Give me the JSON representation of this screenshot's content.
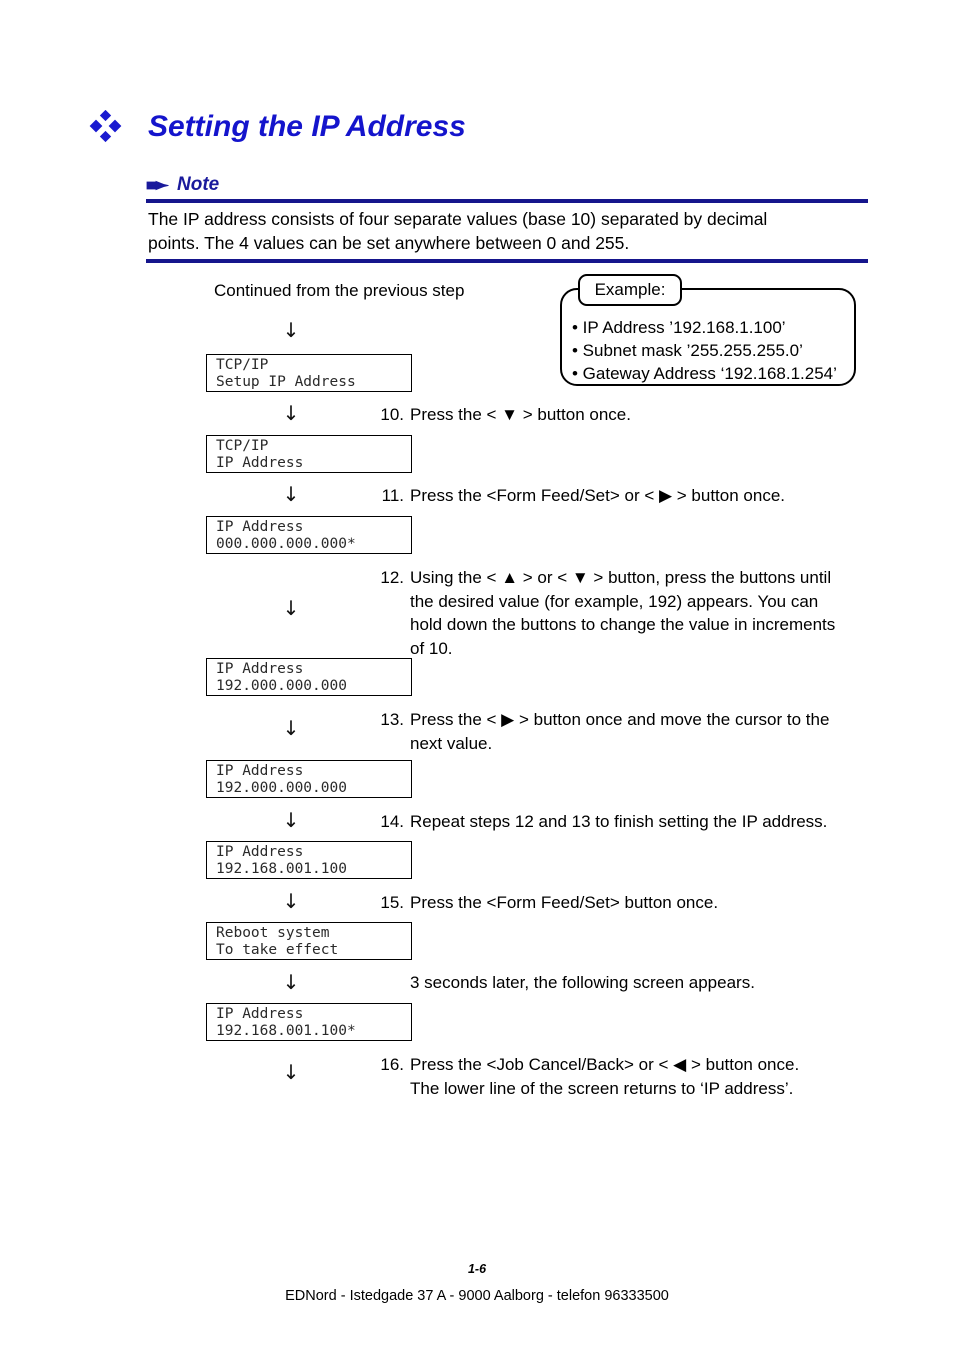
{
  "heading": {
    "bullet_icon": "diamond-cluster-icon",
    "title": "Setting the IP Address",
    "color": "#1414cc"
  },
  "note": {
    "icon": "pencil-icon",
    "title": "Note",
    "rule_color": "#15158c",
    "line1": "The IP address consists of four separate values (base 10) separated by decimal",
    "line2": "points.  The 4 values can be set anywhere between 0 and 255."
  },
  "flow": {
    "intro": "Continued from the previous step",
    "arrow_glyph": "↓",
    "screens": [
      {
        "line1": "TCP/IP",
        "line2": "Setup IP Address"
      },
      {
        "line1": "TCP/IP",
        "line2": "IP Address"
      },
      {
        "line1": "IP Address",
        "line2": "000.000.000.000*"
      },
      {
        "line1": "IP Address",
        "line2": "192.000.000.000"
      },
      {
        "line1": "IP Address",
        "line2": "192.000.000.000"
      },
      {
        "line1": "IP Address",
        "line2": "192.168.001.100"
      },
      {
        "line1": "Reboot system",
        "line2": "To take effect"
      },
      {
        "line1": "IP Address",
        "line2": "192.168.001.100*"
      }
    ],
    "steps": [
      {
        "num": "10.",
        "lines": [
          "Press the < ▼ > button once."
        ]
      },
      {
        "num": "11.",
        "lines": [
          "Press the <Form Feed/Set> or < ▶ > button once."
        ]
      },
      {
        "num": "12.",
        "lines": [
          "Using the < ▲ > or < ▼ > button, press the buttons until",
          "the desired value (for example, 192) appears. You can",
          "hold down the buttons to change the value in increments",
          "of 10."
        ]
      },
      {
        "num": "13.",
        "lines": [
          "Press the < ▶ > button once and move the cursor to the",
          "next value."
        ]
      },
      {
        "num": "14.",
        "lines": [
          "Repeat steps 12 and 13 to finish setting the IP address."
        ]
      },
      {
        "num": "15.",
        "lines": [
          "Press the <Form Feed/Set> button once."
        ]
      },
      {
        "num": "16.",
        "lines": [
          "Press the <Job Cancel/Back> or < ◀ > button once.",
          "The lower line of the screen returns to ‘IP address’."
        ]
      }
    ],
    "timing_note": "3 seconds later, the following screen appears."
  },
  "example": {
    "label": "Example:",
    "items": [
      "• IP Address ’192.168.1.100’",
      "• Subnet mask ’255.255.255.0’",
      "• Gateway Address ‘192.168.1.254’"
    ]
  },
  "footer": {
    "page_number": "1-6",
    "credit": "EDNord - Istedgade 37 A - 9000 Aalborg - telefon 96333500"
  }
}
